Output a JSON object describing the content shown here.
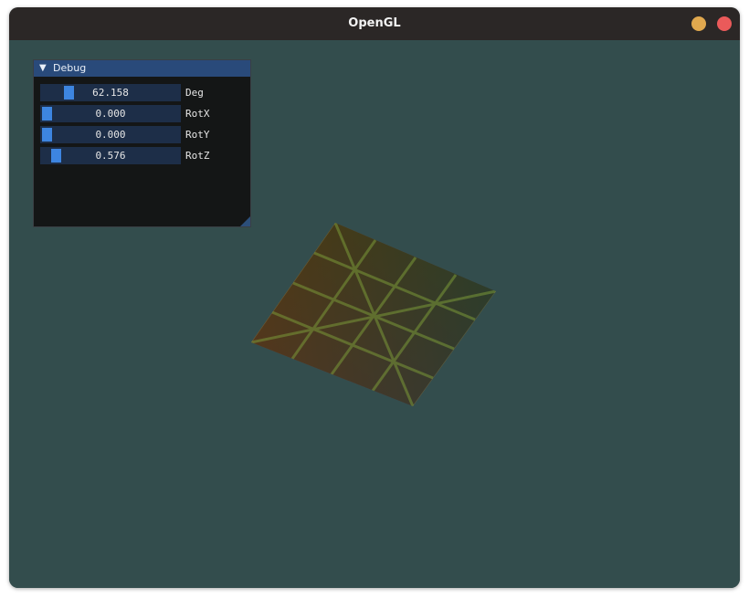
{
  "window": {
    "title": "OpenGL"
  },
  "colors": {
    "titlebar": "#2b2726",
    "minimize": "#e0a84e",
    "close": "#ea5a5a",
    "clear_color": "#334d4d",
    "panel_bg": "#141616",
    "panel_header": "#294a7a",
    "slider_bg": "#1d2e48",
    "slider_grab": "#3d85e0"
  },
  "debug_panel": {
    "title": "Debug",
    "collapse_icon": "triangle-down-icon",
    "sliders": [
      {
        "label": "Deg",
        "value": "62.158",
        "fraction": 0.17
      },
      {
        "label": "RotX",
        "value": "0.000",
        "fraction": 0.0
      },
      {
        "label": "RotY",
        "value": "0.000",
        "fraction": 0.0
      },
      {
        "label": "RotZ",
        "value": "0.576",
        "fraction": 0.07
      }
    ]
  }
}
